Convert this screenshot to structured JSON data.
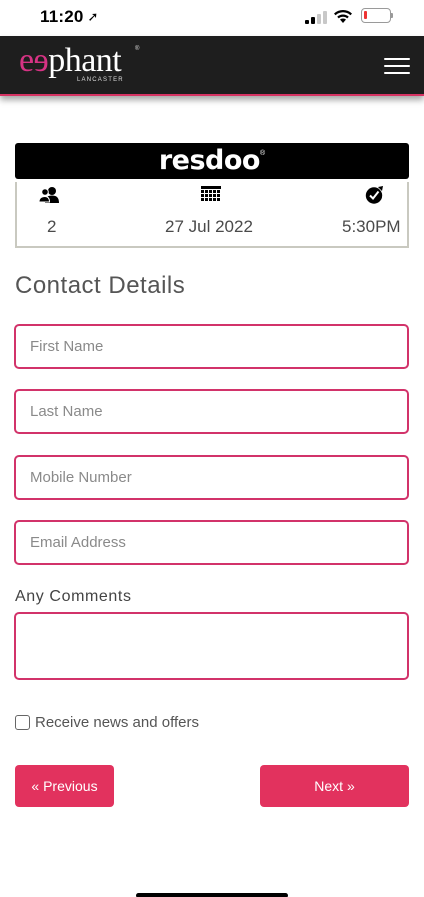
{
  "status_bar": {
    "time": "11:20",
    "location_arrow": "➤",
    "battery_color": "#e33333"
  },
  "header": {
    "logo_ele": "eɘ",
    "logo_phant": "phant",
    "logo_sub": "LANCASTER",
    "logo_reg": "®",
    "menu_icon": "hamburger-icon",
    "background": "#1e1e1e",
    "accent": "#d63384"
  },
  "widget": {
    "brand": "resdoo",
    "brand_reg": "®",
    "guests_icon": "users-icon",
    "guests": "2",
    "date_icon": "calendar-icon",
    "date": "27 Jul 2022",
    "time_icon": "clock-check-icon",
    "time": "5:30PM"
  },
  "form": {
    "title": "Contact Details",
    "first_name_placeholder": "First Name",
    "last_name_placeholder": "Last Name",
    "mobile_placeholder": "Mobile Number",
    "email_placeholder": "Email Address",
    "comments_label": "Any Comments",
    "comments_value": "",
    "newsletter_label": "Receive news and offers",
    "newsletter_checked": false,
    "border_color": "#d2336a"
  },
  "nav": {
    "previous_label": "« Previous",
    "next_label": "Next »",
    "button_color": "#e2325e"
  }
}
